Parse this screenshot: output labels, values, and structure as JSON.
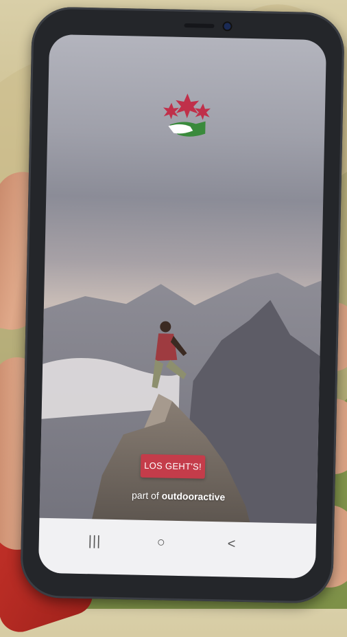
{
  "screen": {
    "cta_label": "LOS GEHT'S!",
    "footer_prefix": "part of ",
    "footer_brand": "outdooractive"
  },
  "navbar": {
    "recent_icon": "|||",
    "home_icon": "○",
    "back_icon": "<"
  },
  "colors": {
    "cta": "#c43c4a",
    "logo_flower": "#c0304a",
    "logo_hand_green": "#3a8a3c",
    "navbar": "#f1f1f3"
  }
}
